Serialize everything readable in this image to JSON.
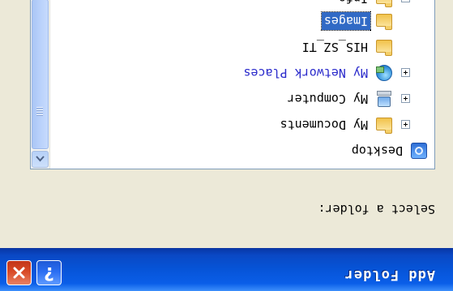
{
  "window": {
    "title": "Add Folder",
    "help_glyph": "?",
    "close_glyph": "✕"
  },
  "prompt": {
    "label": "Select a folder:"
  },
  "tree": {
    "items": [
      {
        "label": "Desktop",
        "icon": "desktop-icon",
        "expander": false,
        "selected": false,
        "link": false
      },
      {
        "label": "My Documents",
        "icon": "folder-icon",
        "expander": true,
        "selected": false,
        "link": false
      },
      {
        "label": "My Computer",
        "icon": "computer-icon",
        "expander": true,
        "selected": false,
        "link": false
      },
      {
        "label": "My Network Places",
        "icon": "network-icon",
        "expander": true,
        "selected": false,
        "link": true
      },
      {
        "label": "HIS_SZ_TI",
        "icon": "folder-icon",
        "expander": false,
        "selected": false,
        "link": false
      },
      {
        "label": "Images",
        "icon": "folder-icon",
        "expander": false,
        "selected": true,
        "link": false
      },
      {
        "label": "Info",
        "icon": "folder-icon",
        "expander": true,
        "selected": false,
        "link": false
      }
    ]
  },
  "colors": {
    "titlebar": "#0653d6",
    "selection": "#316ac5",
    "link_text": "#2a2acb",
    "dialog_bg": "#ece9d8"
  }
}
